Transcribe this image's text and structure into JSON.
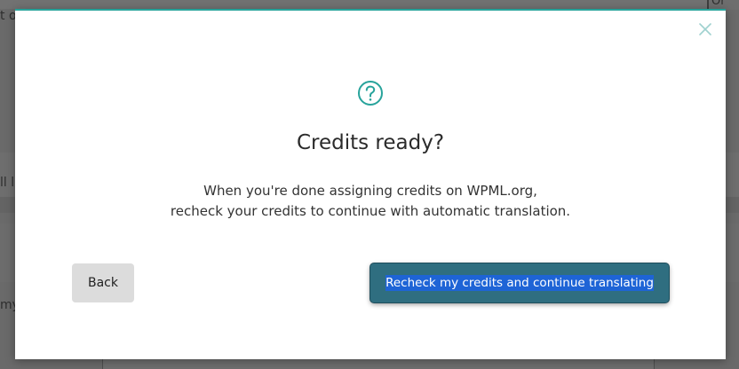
{
  "background": {
    "fragment_top_left": "t o",
    "fragment_middle_left": "ll la",
    "fragment_lower_left": "my",
    "fragment_top_right": "Or"
  },
  "modal": {
    "accent_color": "#27a39b",
    "close_icon": "close-icon",
    "help_icon": "question-circle-icon",
    "title": "Credits ready?",
    "description_line1": "When you're done assigning credits on WPML.org,",
    "description_line2": "recheck your credits to continue with automatic translation.",
    "back_label": "Back",
    "primary_label": "Recheck my credits and continue translating",
    "primary_color": "#2f6e80"
  }
}
